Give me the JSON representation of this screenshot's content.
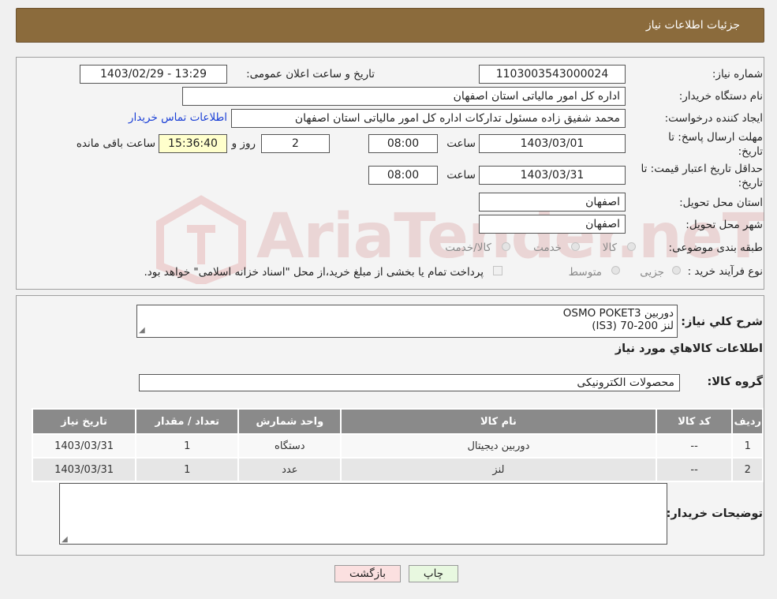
{
  "header": {
    "title": "جزئیات اطلاعات نیاز"
  },
  "need_number": {
    "label": "شماره نیاز:",
    "value": "1103003543000024"
  },
  "announce": {
    "label": "تاریخ و ساعت اعلان عمومی:",
    "value": "1403/02/29 - 13:29"
  },
  "buyer_org": {
    "label": "نام دستگاه خریدار:",
    "value": "اداره کل امور مالیاتی استان اصفهان"
  },
  "requester": {
    "label": "ایجاد کننده درخواست:",
    "value": "محمد شفیق زاده مسئول تداركات اداره کل امور مالیاتی استان اصفهان",
    "contact_link": "اطلاعات تماس خریدار"
  },
  "response_deadline": {
    "label_line1": "مهلت ارسال پاسخ: تا",
    "label_line2": "تاریخ:",
    "date": "1403/03/01",
    "time_label": "ساعت",
    "time": "08:00",
    "days": "2",
    "days_label": "روز و",
    "remaining": "15:36:40",
    "remaining_label": "ساعت باقی مانده"
  },
  "price_validity": {
    "label_line1": "حداقل تاریخ اعتبار قیمت: تا",
    "label_line2": "تاریخ:",
    "date": "1403/03/31",
    "time_label": "ساعت",
    "time": "08:00"
  },
  "province": {
    "label": "استان محل تحویل:",
    "value": "اصفهان"
  },
  "city": {
    "label": "شهر محل تحویل:",
    "value": "اصفهان"
  },
  "category": {
    "label": "طبقه بندی موضوعی:",
    "options": [
      "کالا",
      "خدمت",
      "کالا/خدمت"
    ]
  },
  "purchase_type": {
    "label": "نوع فرآیند خرید :",
    "options": [
      "جزیی",
      "متوسط"
    ],
    "note": "پرداخت تمام یا بخشی از مبلغ خرید،از محل \"اسناد خزانه اسلامی\" خواهد بود."
  },
  "description": {
    "label": "شرح كلي نياز:",
    "line1": "دوربین OSMO POKET3",
    "line2": "لنز 200-70 (IS3)"
  },
  "items_section": {
    "title": "اطلاعات كالاهاي مورد نياز"
  },
  "goods_group": {
    "label": "گروه كالا:",
    "value": "محصولات الکترونیکی"
  },
  "table": {
    "headers": [
      "ردیف",
      "کد کالا",
      "نام کالا",
      "واحد شمارش",
      "تعداد / مقدار",
      "تاریخ نیاز"
    ],
    "rows": [
      [
        "1",
        "--",
        "دوربین دیجیتال",
        "دستگاه",
        "1",
        "1403/03/31"
      ],
      [
        "2",
        "--",
        "لنز",
        "عدد",
        "1",
        "1403/03/31"
      ]
    ]
  },
  "buyer_notes": {
    "label": "توضیحات خریدار:",
    "value": ""
  },
  "buttons": {
    "print": "چاپ",
    "back": "بازگشت"
  },
  "watermark": {
    "text": "AriaTender.neT"
  },
  "colors": {
    "header_bg": "#8b6b3c",
    "table_header_bg": "#8a8a8a",
    "remaining_bg": "#ffffcc",
    "print_button_bg": "#e8f8e0",
    "back_button_bg": "#fbe0e0",
    "link": "#1a3fd6"
  }
}
